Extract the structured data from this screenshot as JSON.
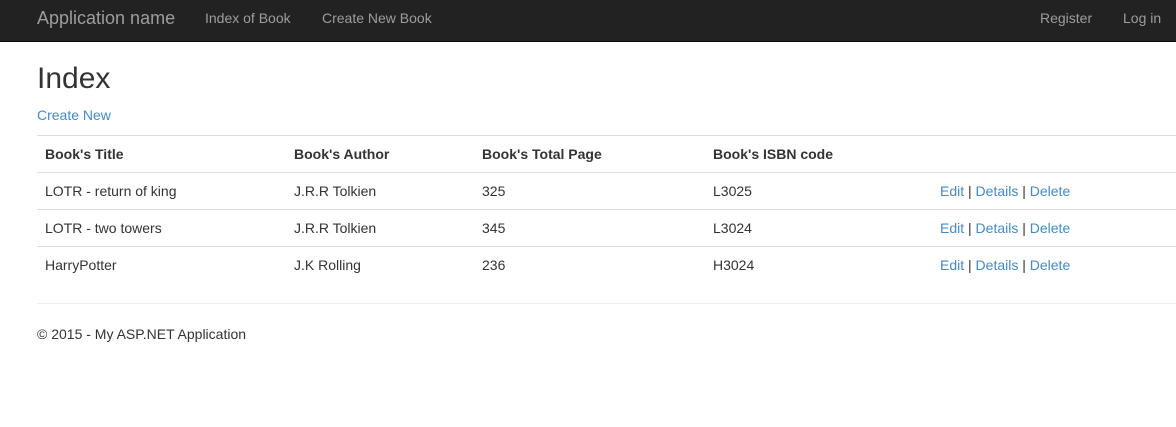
{
  "navbar": {
    "brand": "Application name",
    "left_links": [
      "Index of Book",
      "Create New Book"
    ],
    "right_links": [
      "Register",
      "Log in"
    ]
  },
  "page": {
    "title": "Index",
    "create_new_label": "Create New"
  },
  "table": {
    "headers": [
      "Book's Title",
      "Book's Author",
      "Book's Total Page",
      "Book's ISBN code"
    ],
    "rows": [
      {
        "title": "LOTR - return of king",
        "author": "J.R.R Tolkien",
        "pages": "325",
        "isbn": "L3025"
      },
      {
        "title": "LOTR - two towers",
        "author": "J.R.R Tolkien",
        "pages": "345",
        "isbn": "L3024"
      },
      {
        "title": "HarryPotter",
        "author": "J.K Rolling",
        "pages": "236",
        "isbn": "H3024"
      }
    ],
    "actions": {
      "edit": "Edit",
      "details": "Details",
      "delete": "Delete",
      "separator": "|"
    }
  },
  "footer": {
    "text": "© 2015 - My ASP.NET Application"
  },
  "colors": {
    "navbar_bg": "#222222",
    "navbar_text": "#9d9d9d",
    "link": "#428bca",
    "text": "#333333",
    "border": "#dddddd"
  }
}
